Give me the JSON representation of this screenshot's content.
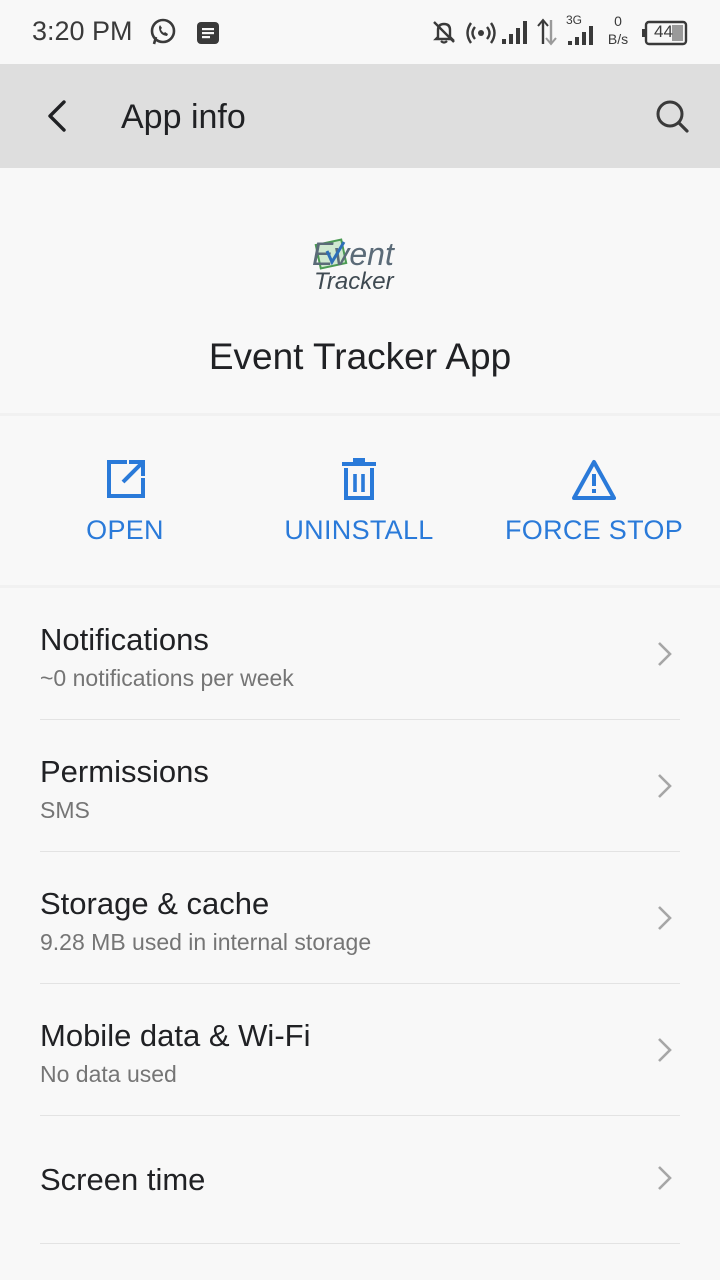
{
  "status_bar": {
    "time": "3:20 PM",
    "net_speed_value": "0",
    "net_speed_unit": "B/s",
    "network_type": "3G",
    "battery": "44",
    "icons": [
      "whatsapp-icon",
      "message-icon",
      "notifications-off-icon",
      "hotspot-icon",
      "signal-icon",
      "data-arrows-icon",
      "signal-3g-icon",
      "battery-icon"
    ]
  },
  "app_bar": {
    "title": "App info"
  },
  "app": {
    "logo_line1": "Event",
    "logo_line2": "Tracker",
    "name": "Event Tracker App"
  },
  "actions": [
    {
      "label": "OPEN",
      "icon": "open-external-icon"
    },
    {
      "label": "UNINSTALL",
      "icon": "trash-icon"
    },
    {
      "label": "FORCE STOP",
      "icon": "warning-icon"
    }
  ],
  "settings": [
    {
      "title": "Notifications",
      "subtitle": "~0 notifications per week"
    },
    {
      "title": "Permissions",
      "subtitle": "SMS"
    },
    {
      "title": "Storage & cache",
      "subtitle": "9.28 MB used in internal storage"
    },
    {
      "title": "Mobile data & Wi-Fi",
      "subtitle": "No data used"
    },
    {
      "title": "Screen time",
      "subtitle": ""
    }
  ],
  "colors": {
    "accent": "#2a7ad9",
    "app_bar": "#dedede",
    "background": "#f8f8f8"
  }
}
